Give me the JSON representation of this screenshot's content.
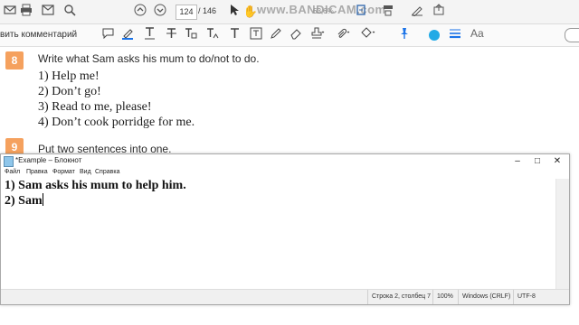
{
  "viewer": {
    "page_current": "124",
    "page_separator": "/",
    "page_total": "146",
    "zoom": "63,6%",
    "watermark": "www.BANDICAM.com",
    "comment_label": "вить комментарий",
    "font_size_label": "Aa",
    "accent_color": "#22aae6"
  },
  "document": {
    "task8": {
      "number": "8",
      "instruction": "Write what Sam asks his mum to do/not to do.",
      "items": [
        "1) Help me!",
        "2) Don’t go!",
        "3) Read to me, please!",
        "4) Don’t cook porridge for me."
      ]
    },
    "task9": {
      "number": "9",
      "instruction": "Put two sentences into one."
    }
  },
  "notepad": {
    "title": "*Example – Блокнот",
    "menu": [
      "Файл",
      "Правка",
      "Формат",
      "Вид",
      "Справка"
    ],
    "lines": [
      "1) Sam asks his mum to help him.",
      "2) Sam"
    ],
    "status": {
      "position": "Строка 2, столбец 7",
      "zoom": "100%",
      "line_ending": "Windows (CRLF)",
      "encoding": "UTF-8"
    }
  }
}
